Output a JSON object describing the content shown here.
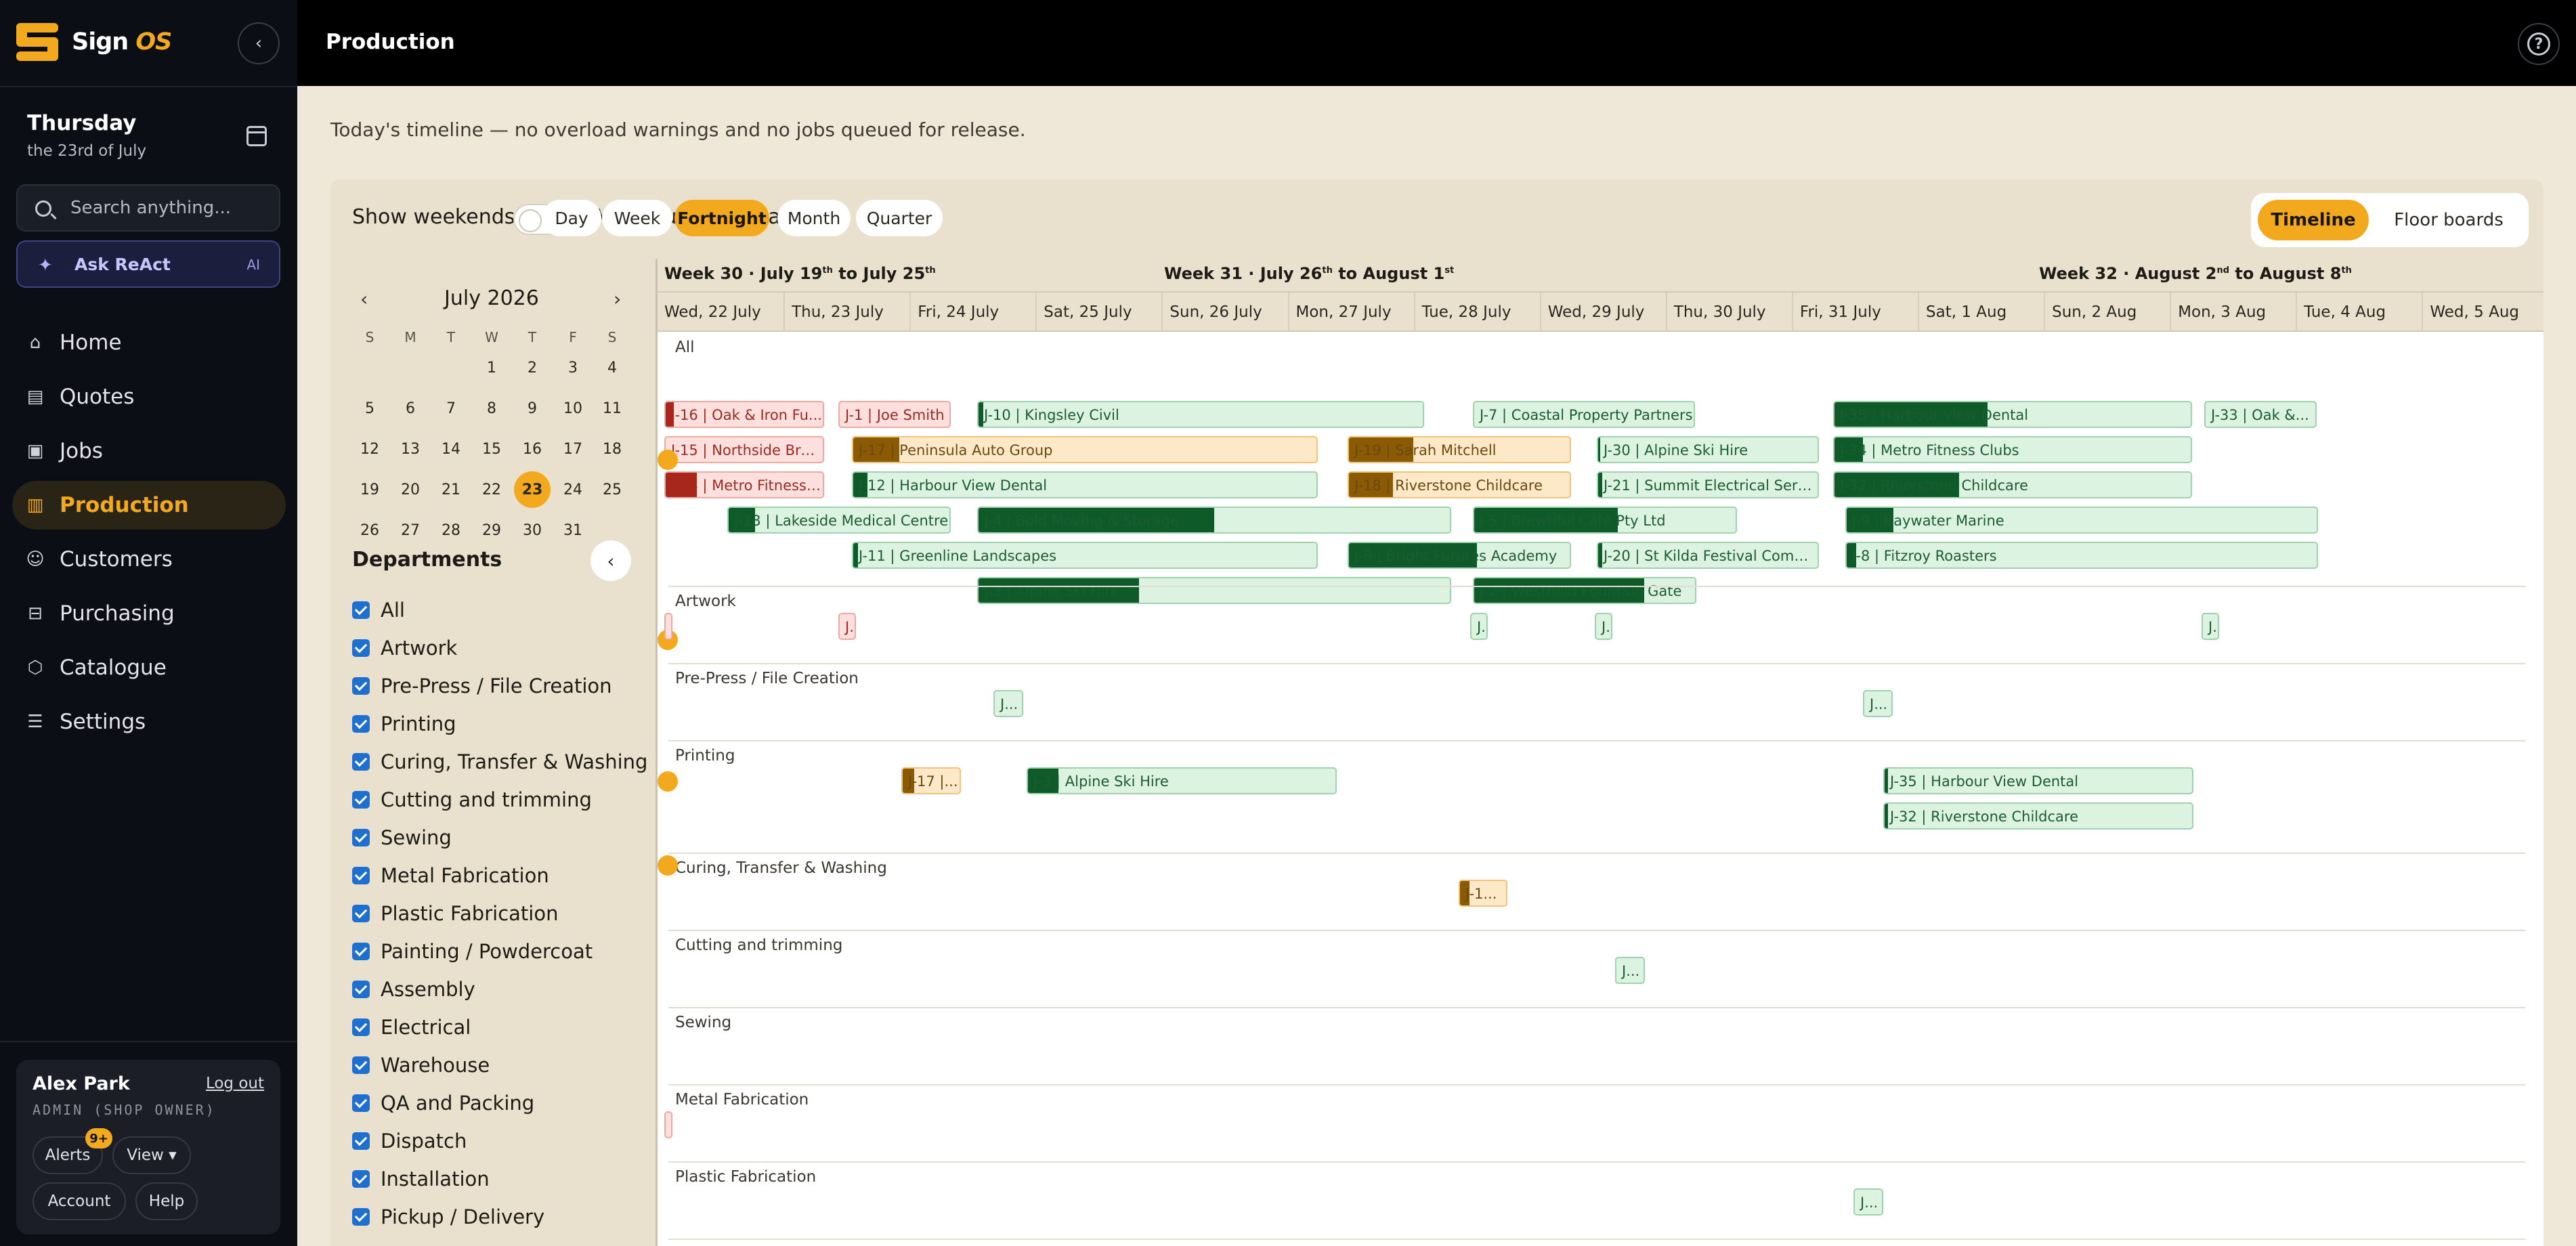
{
  "brand": {
    "name": "Sign",
    "suffix": "OS"
  },
  "sidebar": {
    "day": "Thursday",
    "date": "the 23rd of July",
    "search_placeholder": "Search anything...",
    "ask": "Ask ReAct",
    "ask_badge": "AI",
    "nav": [
      {
        "label": "Home",
        "icon": "home-icon",
        "glyph": "⌂"
      },
      {
        "label": "Quotes",
        "icon": "document-icon",
        "glyph": "▤"
      },
      {
        "label": "Jobs",
        "icon": "briefcase-icon",
        "glyph": "▣"
      },
      {
        "label": "Production",
        "icon": "bar-chart-icon",
        "glyph": "▥"
      },
      {
        "label": "Customers",
        "icon": "users-icon",
        "glyph": "☺"
      },
      {
        "label": "Purchasing",
        "icon": "cart-icon",
        "glyph": "⊟"
      },
      {
        "label": "Catalogue",
        "icon": "box-icon",
        "glyph": "⬡"
      },
      {
        "label": "Settings",
        "icon": "sliders-icon",
        "glyph": "☰"
      }
    ],
    "user": {
      "name": "Alex Park",
      "role": "ADMIN (SHOP OWNER)",
      "logout": "Log out",
      "alerts": "Alerts",
      "alerts_badge": "9+",
      "view": "View ▾",
      "account": "Account",
      "help": "Help"
    }
  },
  "header": {
    "title": "Production",
    "help_glyph": "?"
  },
  "subtitle": "Today's timeline — no overload warnings and no jobs queued for release.",
  "controls": {
    "show_weekends": "Show weekends",
    "public_holidays": "Mark public holidays",
    "ranges": [
      "Day",
      "Week",
      "Fortnight",
      "Month",
      "Quarter"
    ],
    "active_range": "Fortnight",
    "views": [
      "Timeline",
      "Floor boards"
    ],
    "active_view": "Timeline"
  },
  "calendar": {
    "month": "July 2026",
    "prev": "‹",
    "next": "›",
    "dow": [
      "S",
      "M",
      "T",
      "W",
      "T",
      "F",
      "S"
    ],
    "weeks": [
      [
        "",
        "",
        "",
        "1",
        "2",
        "3",
        "4"
      ],
      [
        "5",
        "6",
        "7",
        "8",
        "9",
        "10",
        "11"
      ],
      [
        "12",
        "13",
        "14",
        "15",
        "16",
        "17",
        "18"
      ],
      [
        "19",
        "20",
        "21",
        "22",
        "23",
        "24",
        "25"
      ],
      [
        "26",
        "27",
        "28",
        "29",
        "30",
        "31",
        ""
      ]
    ],
    "today": "23"
  },
  "departments": {
    "title": "Departments",
    "items": [
      "All",
      "Artwork",
      "Pre-Press / File Creation",
      "Printing",
      "Curing, Transfer & Washing",
      "Cutting and trimming",
      "Sewing",
      "Metal Fabrication",
      "Plastic Fabrication",
      "Painting / Powdercoat",
      "Assembly",
      "Electrical",
      "Warehouse",
      "QA and Packing",
      "Dispatch",
      "Installation",
      "Pickup / Delivery"
    ]
  },
  "timeline": {
    "weeks": [
      {
        "week": "Week 30",
        "from": "July 19",
        "from_sup": "th",
        "to": "July 25",
        "to_sup": "th"
      },
      {
        "week": "Week 31",
        "from": "July 26",
        "from_sup": "th",
        "to": "August 1",
        "to_sup": "st"
      },
      {
        "week": "Week 32",
        "from": "August 2",
        "from_sup": "nd",
        "to": "August 8",
        "to_sup": "th"
      }
    ],
    "days": [
      "Wed, 22 July",
      "Thu, 23 July",
      "Fri, 24 July",
      "Sat, 25 July",
      "Sun, 26 July",
      "Mon, 27 July",
      "Tue, 28 July",
      "Wed, 29 July",
      "Thu, 30 July",
      "Fri, 31 July",
      "Sat, 1 Aug",
      "Sun, 2 Aug",
      "Mon, 3 Aug",
      "Tue, 4 Aug",
      "Wed, 5 Aug"
    ],
    "lanes": [
      {
        "name": "All",
        "jobs": [
          {
            "label": "J-16 | Oak & Iron Fu...",
            "c": "r"
          },
          {
            "label": "J-1 | Joe Smith",
            "c": "r"
          },
          {
            "label": "J-10 | Kingsley Civil",
            "c": "g"
          },
          {
            "label": "J-7 | Coastal Property Partners",
            "c": "g"
          },
          {
            "label": "J-35 | Harbour View Dental",
            "c": "g"
          },
          {
            "label": "J-33 | Oak &...",
            "c": "g"
          },
          {
            "label": "J-15 | Northside Bre...",
            "c": "r"
          },
          {
            "label": "J-17 | Peninsula Auto Group",
            "c": "y"
          },
          {
            "label": "J-19 | Sarah Mitchell",
            "c": "y"
          },
          {
            "label": "J-30 | Alpine Ski Hire",
            "c": "g"
          },
          {
            "label": "J-34 | Metro Fitness Clubs",
            "c": "g"
          },
          {
            "label": "J-14 | Metro Fitness ...",
            "c": "r"
          },
          {
            "label": "J-12 | Harbour View Dental",
            "c": "g"
          },
          {
            "label": "J-18 | Riverstone Childcare",
            "c": "y"
          },
          {
            "label": "J-21 | Summit Electrical Servic...",
            "c": "g"
          },
          {
            "label": "J-32 | Riverstone Childcare",
            "c": "g"
          },
          {
            "label": "J-13 | Lakeside Medical Centre",
            "c": "g"
          },
          {
            "label": "J-4 | Bold Moving & Storage",
            "c": "g"
          },
          {
            "label": "J-5 | Brewtiful Café Pty Ltd",
            "c": "g"
          },
          {
            "label": "J-9 | Baywater Marine",
            "c": "g"
          },
          {
            "label": "J-11 | Greenline Landscapes",
            "c": "g"
          },
          {
            "label": "J-6 | Bright Futures Academy",
            "c": "g"
          },
          {
            "label": "J-20 | St Kilda Festival Comm...",
            "c": "g"
          },
          {
            "label": "J-8 | Fitzroy Roasters",
            "c": "g"
          },
          {
            "label": "J-3 | Alpine Ski Hire",
            "c": "g"
          },
          {
            "label": "J-2 | Westfield Fountain Gate",
            "c": "g"
          }
        ]
      },
      {
        "name": "Artwork",
        "jobs": [
          {
            "label": "",
            "c": "r"
          },
          {
            "label": "J.",
            "c": "r"
          },
          {
            "label": "J.",
            "c": "g"
          },
          {
            "label": "J.",
            "c": "g"
          },
          {
            "label": "J.",
            "c": "g"
          }
        ]
      },
      {
        "name": "Pre-Press / File Creation",
        "jobs": [
          {
            "label": "J...",
            "c": "g"
          },
          {
            "label": "J...",
            "c": "g"
          }
        ]
      },
      {
        "name": "Printing",
        "jobs": [
          {
            "label": "J-17 |...",
            "c": "y"
          },
          {
            "label": "J-3 | Alpine Ski Hire",
            "c": "g"
          },
          {
            "label": "J-35 | Harbour View Dental",
            "c": "g"
          },
          {
            "label": "J-32 | Riverstone Childcare",
            "c": "g"
          }
        ]
      },
      {
        "name": "Curing, Transfer & Washing",
        "jobs": [
          {
            "label": "J-1...",
            "c": "y"
          }
        ]
      },
      {
        "name": "Cutting and trimming",
        "jobs": [
          {
            "label": "J...",
            "c": "g"
          }
        ]
      },
      {
        "name": "Sewing",
        "jobs": []
      },
      {
        "name": "Metal Fabrication",
        "jobs": [
          {
            "label": "",
            "c": "r"
          }
        ]
      },
      {
        "name": "Plastic Fabrication",
        "jobs": [
          {
            "label": "J...",
            "c": "g"
          }
        ]
      }
    ]
  }
}
